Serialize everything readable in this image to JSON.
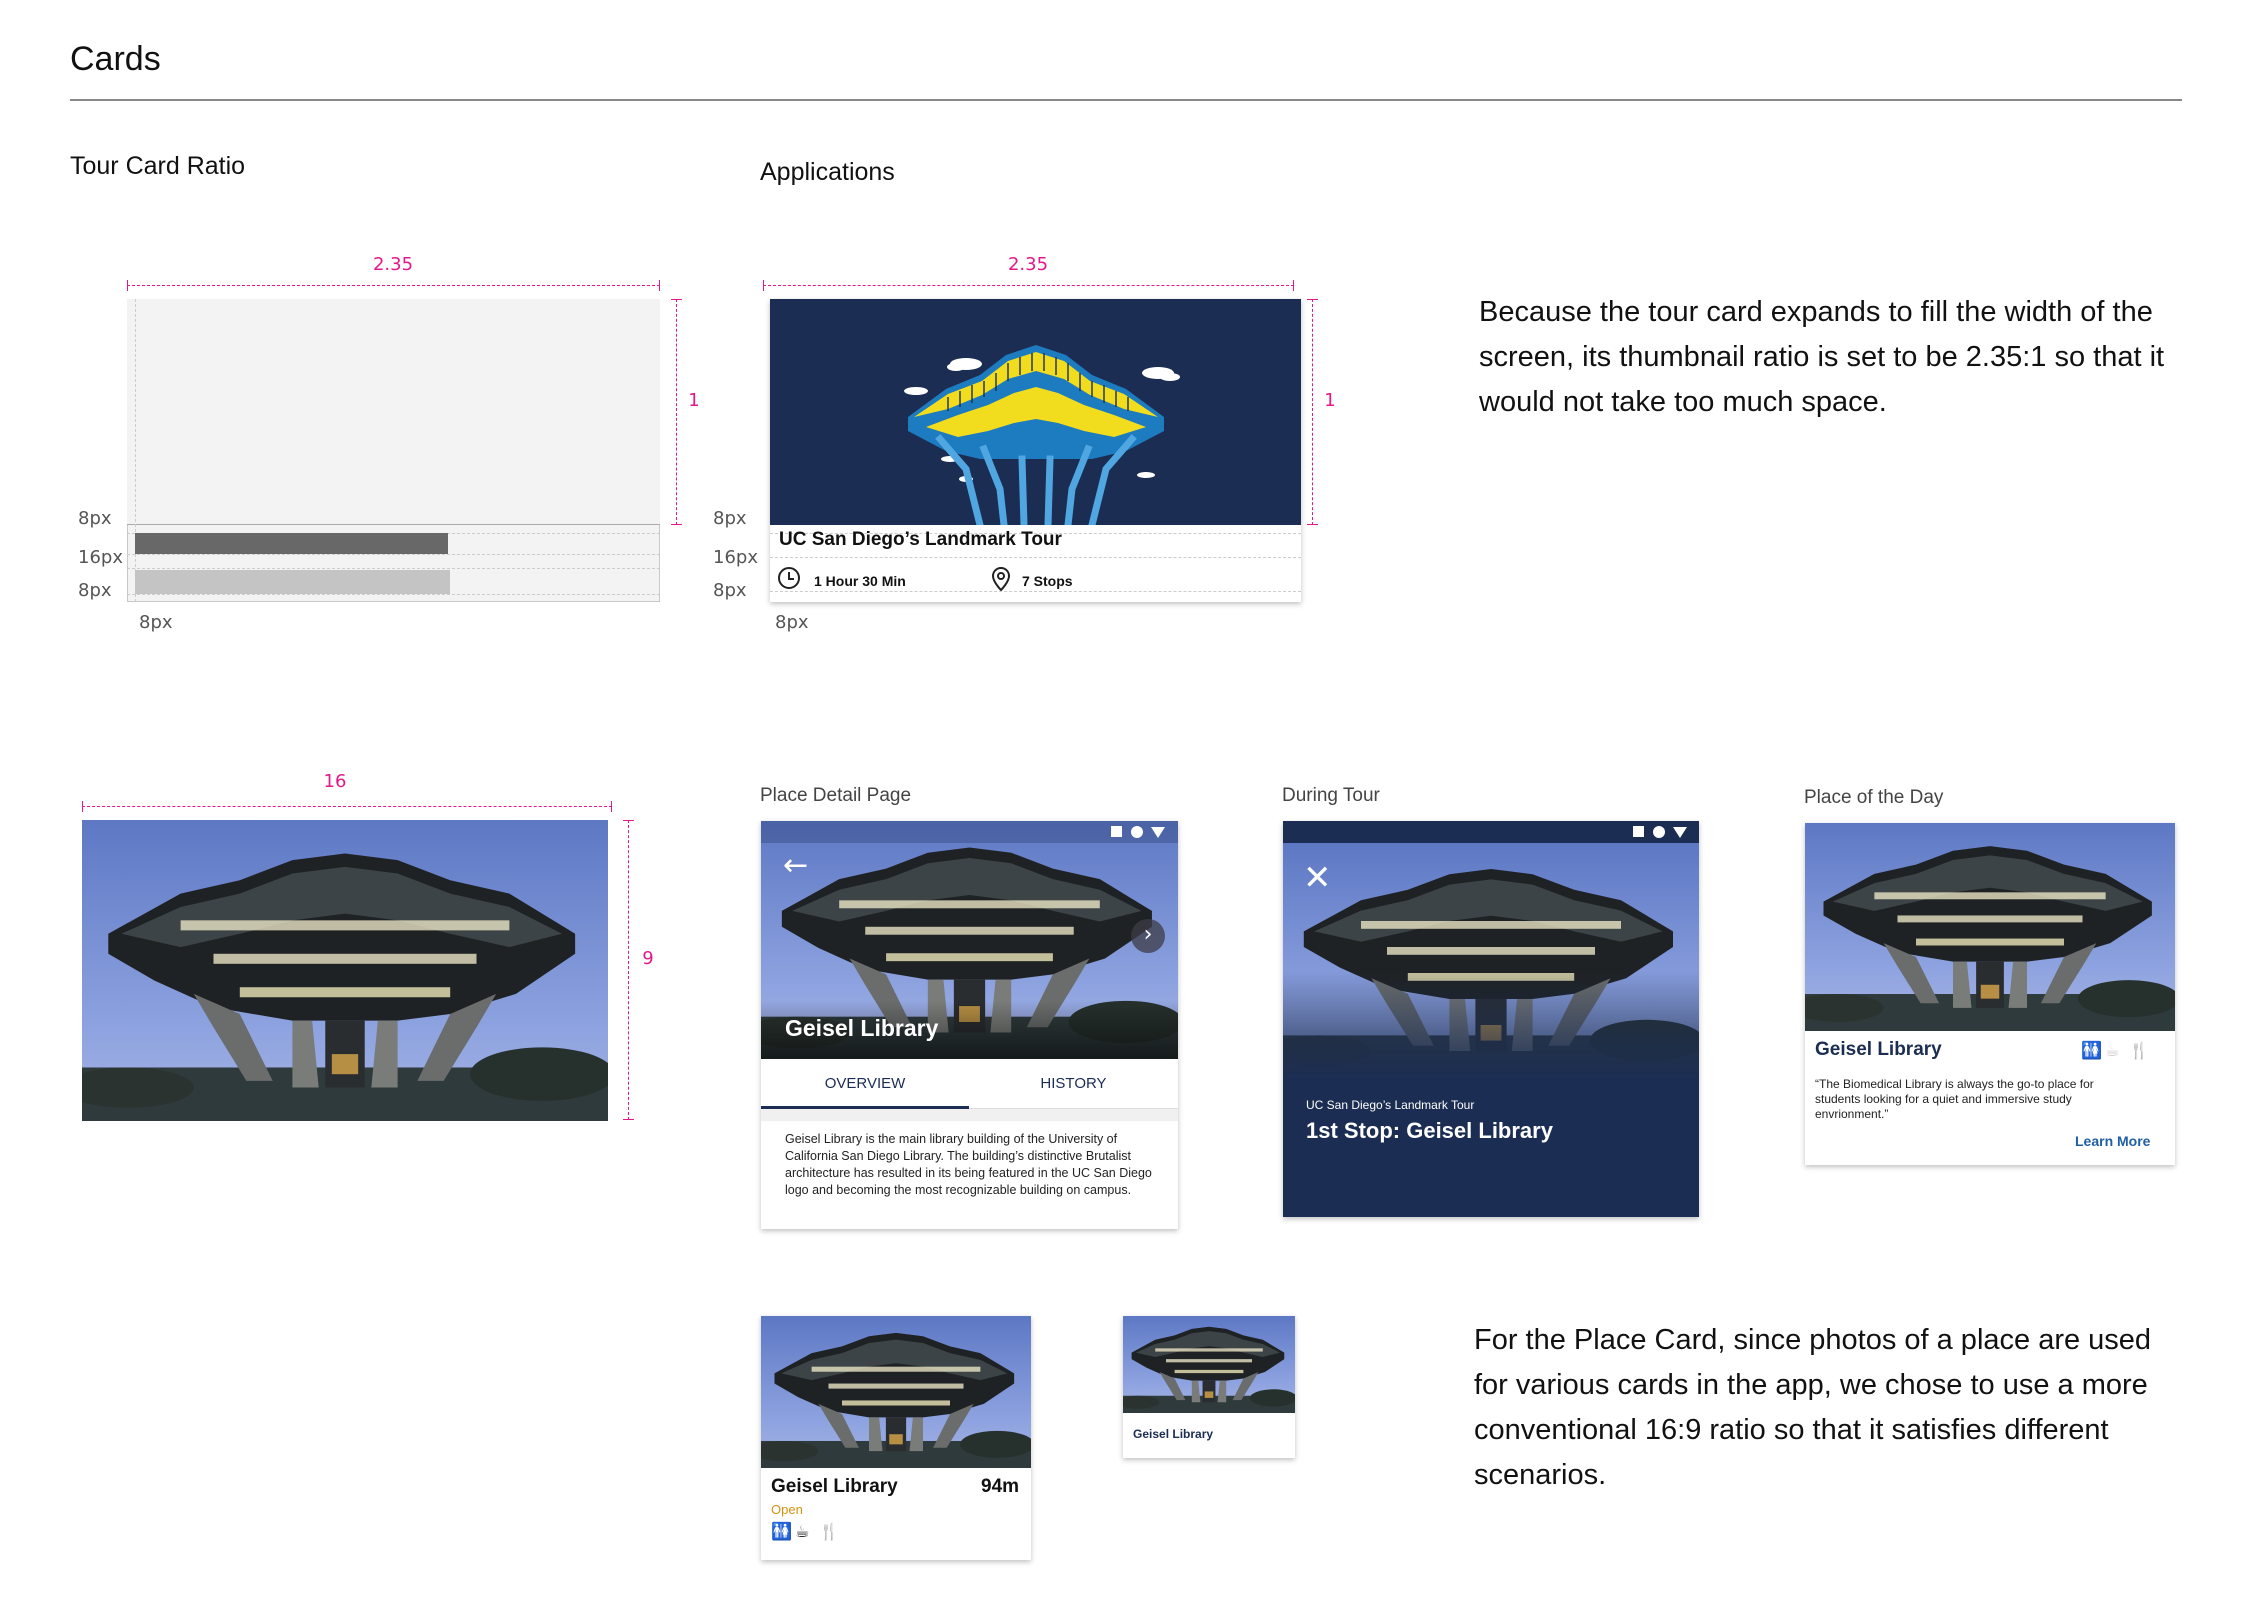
{
  "page": {
    "title": "Cards"
  },
  "sections": {
    "tour_ratio": "Tour Card Ratio",
    "applications": "Applications",
    "place_detail": "Place Detail Page",
    "during_tour": "During Tour",
    "place_of_day": "Place of the Day"
  },
  "dims": {
    "ratio_w": "2.35",
    "ratio_h": "1",
    "app_w": "2.35",
    "app_h": "1",
    "photo_w": "16",
    "photo_h": "9",
    "px8a": "8px",
    "px16": "16px",
    "px8b": "8px",
    "px8c": "8px",
    "app_px8a": "8px",
    "app_px16": "16px",
    "app_px8b": "8px",
    "app_px8c": "8px"
  },
  "tour_card": {
    "title": "UC San Diego’s Landmark Tour",
    "duration": "1 Hour 30 Min",
    "stops": "7 Stops"
  },
  "explanations": {
    "tour": "Because the tour card expands to fill the width of the screen,  its thumbnail ratio is set to be 2.35:1 so that it would not take too much space.",
    "place": "For the Place Card, since photos of a place are used for various cards in the app, we chose to use a more conventional 16:9 ratio so that it satisfies different scenarios."
  },
  "place_detail": {
    "name": "Geisel Library",
    "tabs": [
      "OVERVIEW",
      "HISTORY"
    ],
    "description": "Geisel Library is the main library building of the University of California San Diego Library. The building’s distinctive Brutalist architecture has resulted in its being featured in the UC San Diego logo and becoming the most recognizable building on campus."
  },
  "during_tour": {
    "tour_name": "UC San Diego’s Landmark Tour",
    "stop": "1st Stop: Geisel Library"
  },
  "place_of_day": {
    "name": "Geisel Library",
    "quote": "“The Biomedical Library is always the go-to place for students looking for a quiet and immersive study envrionment.”",
    "link": "Learn More"
  },
  "place_card": {
    "name": "Geisel Library",
    "distance": "94m",
    "status": "Open"
  },
  "mini_card": {
    "name": "Geisel Library"
  },
  "colors": {
    "accent": "#e6178a",
    "navy": "#1b2d52",
    "yellow": "#f2dc1e",
    "open": "#d4930e",
    "link": "#1f5fa6"
  }
}
